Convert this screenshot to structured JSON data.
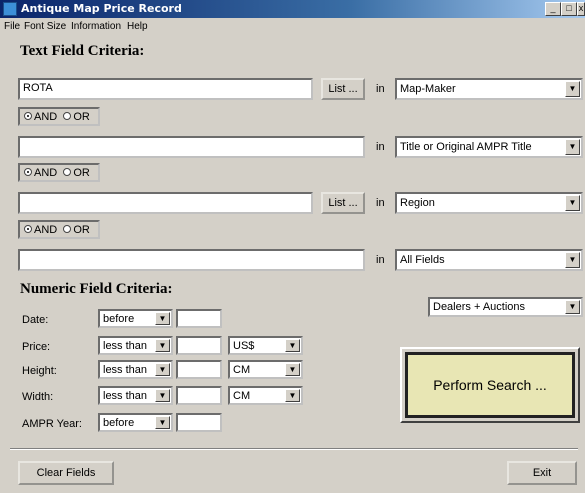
{
  "window": {
    "title": "Antique Map Price Record",
    "buttons": {
      "minimize": "_",
      "maximize": "□",
      "close": "x"
    }
  },
  "menu": [
    "File",
    "Font Size",
    "Information",
    "Help"
  ],
  "text_criteria": {
    "heading": "Text Field Criteria:",
    "rows": [
      {
        "value": "ROTA",
        "list_button": "List ...",
        "in_label": "in",
        "field": "Map-Maker"
      },
      {
        "value": "",
        "list_button": null,
        "in_label": "in",
        "field": "Title or Original AMPR Title"
      },
      {
        "value": "",
        "list_button": "List ...",
        "in_label": "in",
        "field": "Region"
      },
      {
        "value": "",
        "list_button": null,
        "in_label": "in",
        "field": "All Fields"
      }
    ],
    "logic": [
      {
        "and": "AND",
        "or": "OR",
        "selected": "AND"
      },
      {
        "and": "AND",
        "or": "OR",
        "selected": "AND"
      },
      {
        "and": "AND",
        "or": "OR",
        "selected": "AND"
      }
    ]
  },
  "numeric_criteria": {
    "heading": "Numeric Field Criteria:",
    "rows": [
      {
        "label": "Date:",
        "operator": "before",
        "value": "",
        "unit": null
      },
      {
        "label": "Price:",
        "operator": "less than",
        "value": "",
        "unit": "US$"
      },
      {
        "label": "Height:",
        "operator": "less than",
        "value": "",
        "unit": "CM"
      },
      {
        "label": "Width:",
        "operator": "less than",
        "value": "",
        "unit": "CM"
      },
      {
        "label": "AMPR Year:",
        "operator": "before",
        "value": "",
        "unit": null
      }
    ]
  },
  "source_select": "Dealers + Auctions",
  "perform_search": "Perform Search ...",
  "footer": {
    "clear": "Clear Fields",
    "exit": "Exit"
  }
}
